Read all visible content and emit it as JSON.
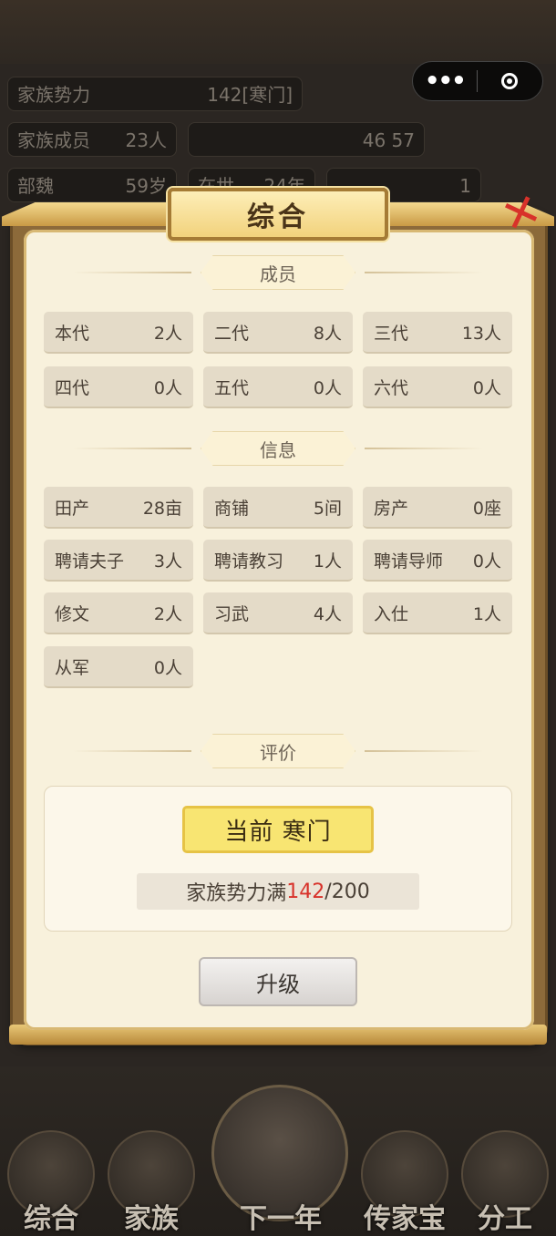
{
  "background": {
    "stats": [
      {
        "label": "家族势力",
        "value": "142[寒门]"
      },
      {
        "label": "家族成员",
        "value": "23人"
      },
      {
        "label": "",
        "value": "46 57"
      },
      {
        "label": "部魏",
        "value": "59岁"
      },
      {
        "label": "在世",
        "value": "24年"
      },
      {
        "label": "",
        "value": "1"
      }
    ]
  },
  "capsule": {
    "more_icon": "more-dots-icon",
    "close_icon": "target-circle-icon"
  },
  "modal": {
    "title": "综合",
    "close_icon": "close-x-icon",
    "members": {
      "header": "成员",
      "cells": [
        {
          "label": "本代",
          "value": "2人"
        },
        {
          "label": "二代",
          "value": "8人"
        },
        {
          "label": "三代",
          "value": "13人"
        },
        {
          "label": "四代",
          "value": "0人"
        },
        {
          "label": "五代",
          "value": "0人"
        },
        {
          "label": "六代",
          "value": "0人"
        }
      ]
    },
    "info": {
      "header": "信息",
      "cells": [
        {
          "label": "田产",
          "value": "28亩"
        },
        {
          "label": "商铺",
          "value": "5间"
        },
        {
          "label": "房产",
          "value": "0座"
        },
        {
          "label": "聘请夫子",
          "value": "3人"
        },
        {
          "label": "聘请教习",
          "value": "1人"
        },
        {
          "label": "聘请导师",
          "value": "0人"
        },
        {
          "label": "修文",
          "value": "2人"
        },
        {
          "label": "习武",
          "value": "4人"
        },
        {
          "label": "入仕",
          "value": "1人"
        },
        {
          "label": "从军",
          "value": "0人"
        }
      ]
    },
    "rating": {
      "header": "评价",
      "rank_text": "当前 寒门",
      "power_prefix": "家族势力满",
      "power_current": "142",
      "power_max": "/200"
    },
    "upgrade_label": "升级"
  },
  "bottom_nav": [
    {
      "label": "综合"
    },
    {
      "label": "家族"
    },
    {
      "label": "下一年"
    },
    {
      "label": "传家宝"
    },
    {
      "label": "分工"
    }
  ]
}
